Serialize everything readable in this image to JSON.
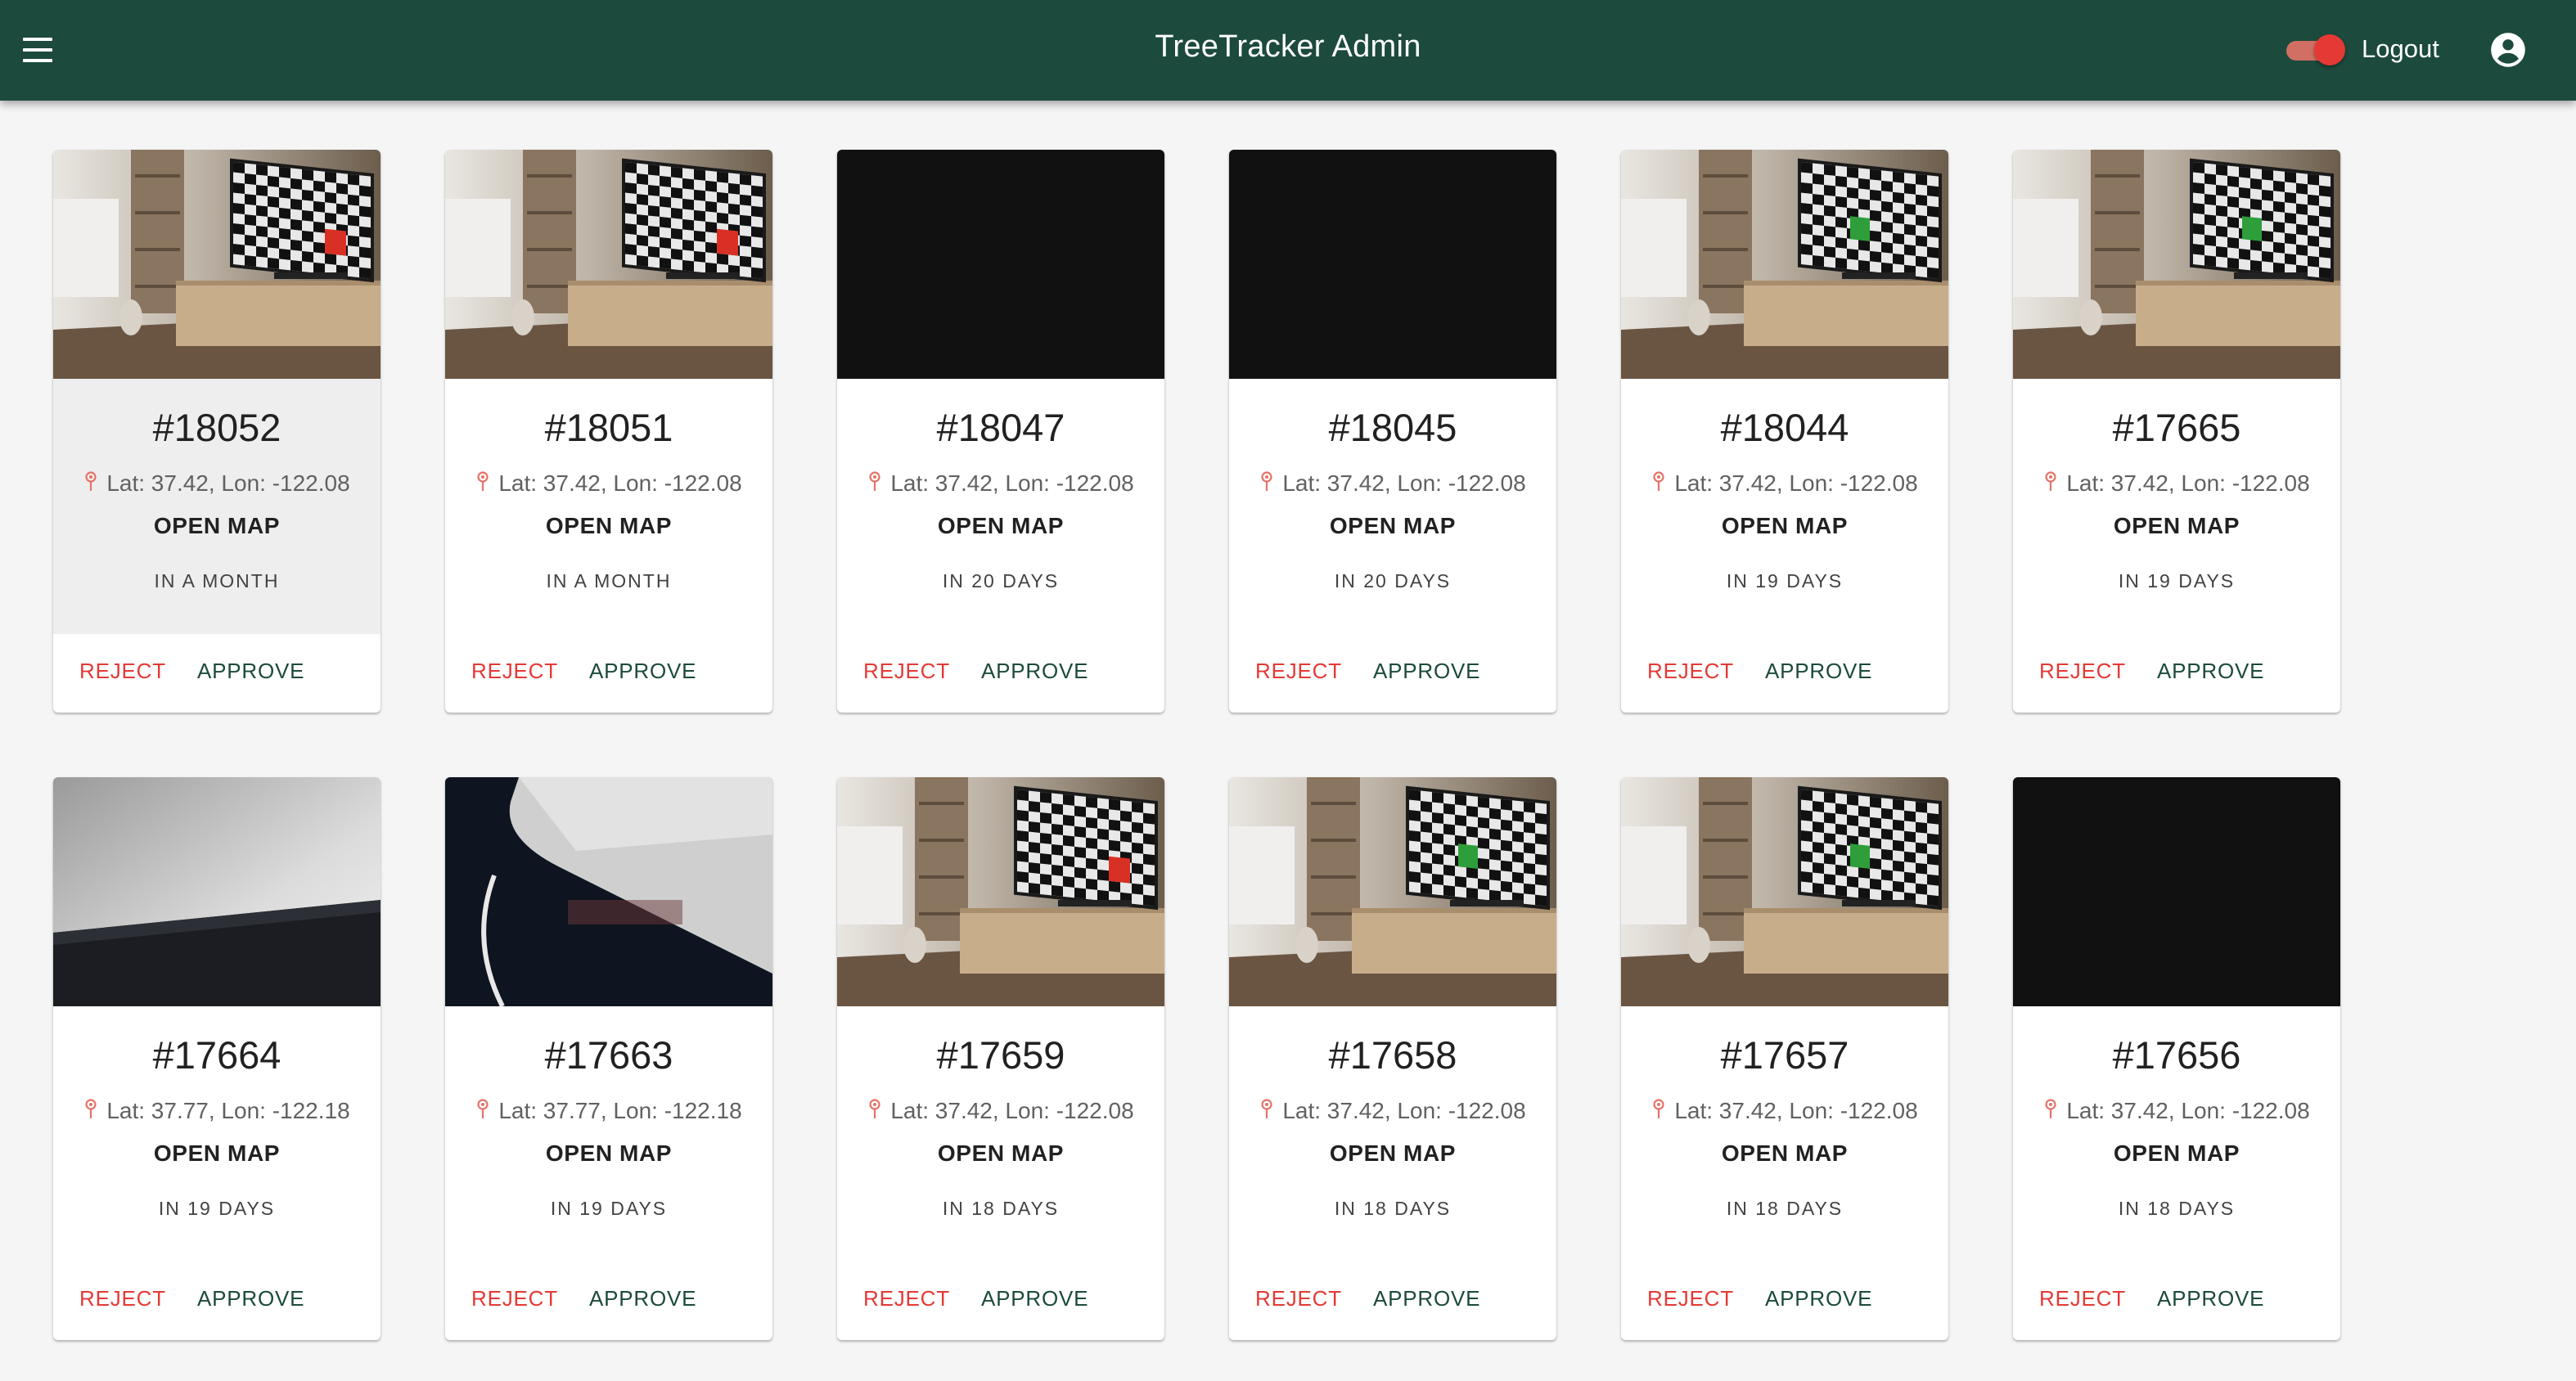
{
  "app": {
    "title": "TreeTracker Admin",
    "logout_label": "Logout",
    "toggle_on": true,
    "accent_color": "#1c4a3d",
    "danger_color": "#e53935"
  },
  "card_actions": {
    "open_map_label": "OPEN MAP",
    "reject_label": "REJECT",
    "approve_label": "APPROVE"
  },
  "cards": [
    {
      "id": "#18052",
      "coords": "Lat: 37.42, Lon: -122.08",
      "time": "IN A MONTH",
      "image": "checker-tv",
      "marker_color": "red",
      "selected": true
    },
    {
      "id": "#18051",
      "coords": "Lat: 37.42, Lon: -122.08",
      "time": "IN A MONTH",
      "image": "checker-tv",
      "marker_color": "red",
      "selected": false
    },
    {
      "id": "#18047",
      "coords": "Lat: 37.42, Lon: -122.08",
      "time": "IN 20 DAYS",
      "image": "black",
      "marker_color": "",
      "selected": false
    },
    {
      "id": "#18045",
      "coords": "Lat: 37.42, Lon: -122.08",
      "time": "IN 20 DAYS",
      "image": "black",
      "marker_color": "",
      "selected": false
    },
    {
      "id": "#18044",
      "coords": "Lat: 37.42, Lon: -122.08",
      "time": "IN 19 DAYS",
      "image": "checker-tv",
      "marker_color": "green",
      "selected": false
    },
    {
      "id": "#17665",
      "coords": "Lat: 37.42, Lon: -122.08",
      "time": "IN 19 DAYS",
      "image": "checker-tv",
      "marker_color": "green",
      "selected": false
    },
    {
      "id": "#17664",
      "coords": "Lat: 37.77, Lon: -122.18",
      "time": "IN 19 DAYS",
      "image": "gray-surface",
      "marker_color": "",
      "selected": false
    },
    {
      "id": "#17663",
      "coords": "Lat: 37.77, Lon: -122.18",
      "time": "IN 19 DAYS",
      "image": "laptop-corner",
      "marker_color": "",
      "selected": false
    },
    {
      "id": "#17659",
      "coords": "Lat: 37.42, Lon: -122.08",
      "time": "IN 18 DAYS",
      "image": "checker-tv",
      "marker_color": "red",
      "selected": false
    },
    {
      "id": "#17658",
      "coords": "Lat: 37.42, Lon: -122.08",
      "time": "IN 18 DAYS",
      "image": "checker-tv",
      "marker_color": "green",
      "selected": false
    },
    {
      "id": "#17657",
      "coords": "Lat: 37.42, Lon: -122.08",
      "time": "IN 18 DAYS",
      "image": "checker-tv",
      "marker_color": "green",
      "selected": false
    },
    {
      "id": "#17656",
      "coords": "Lat: 37.42, Lon: -122.08",
      "time": "IN 18 DAYS",
      "image": "black",
      "marker_color": "",
      "selected": false
    }
  ]
}
